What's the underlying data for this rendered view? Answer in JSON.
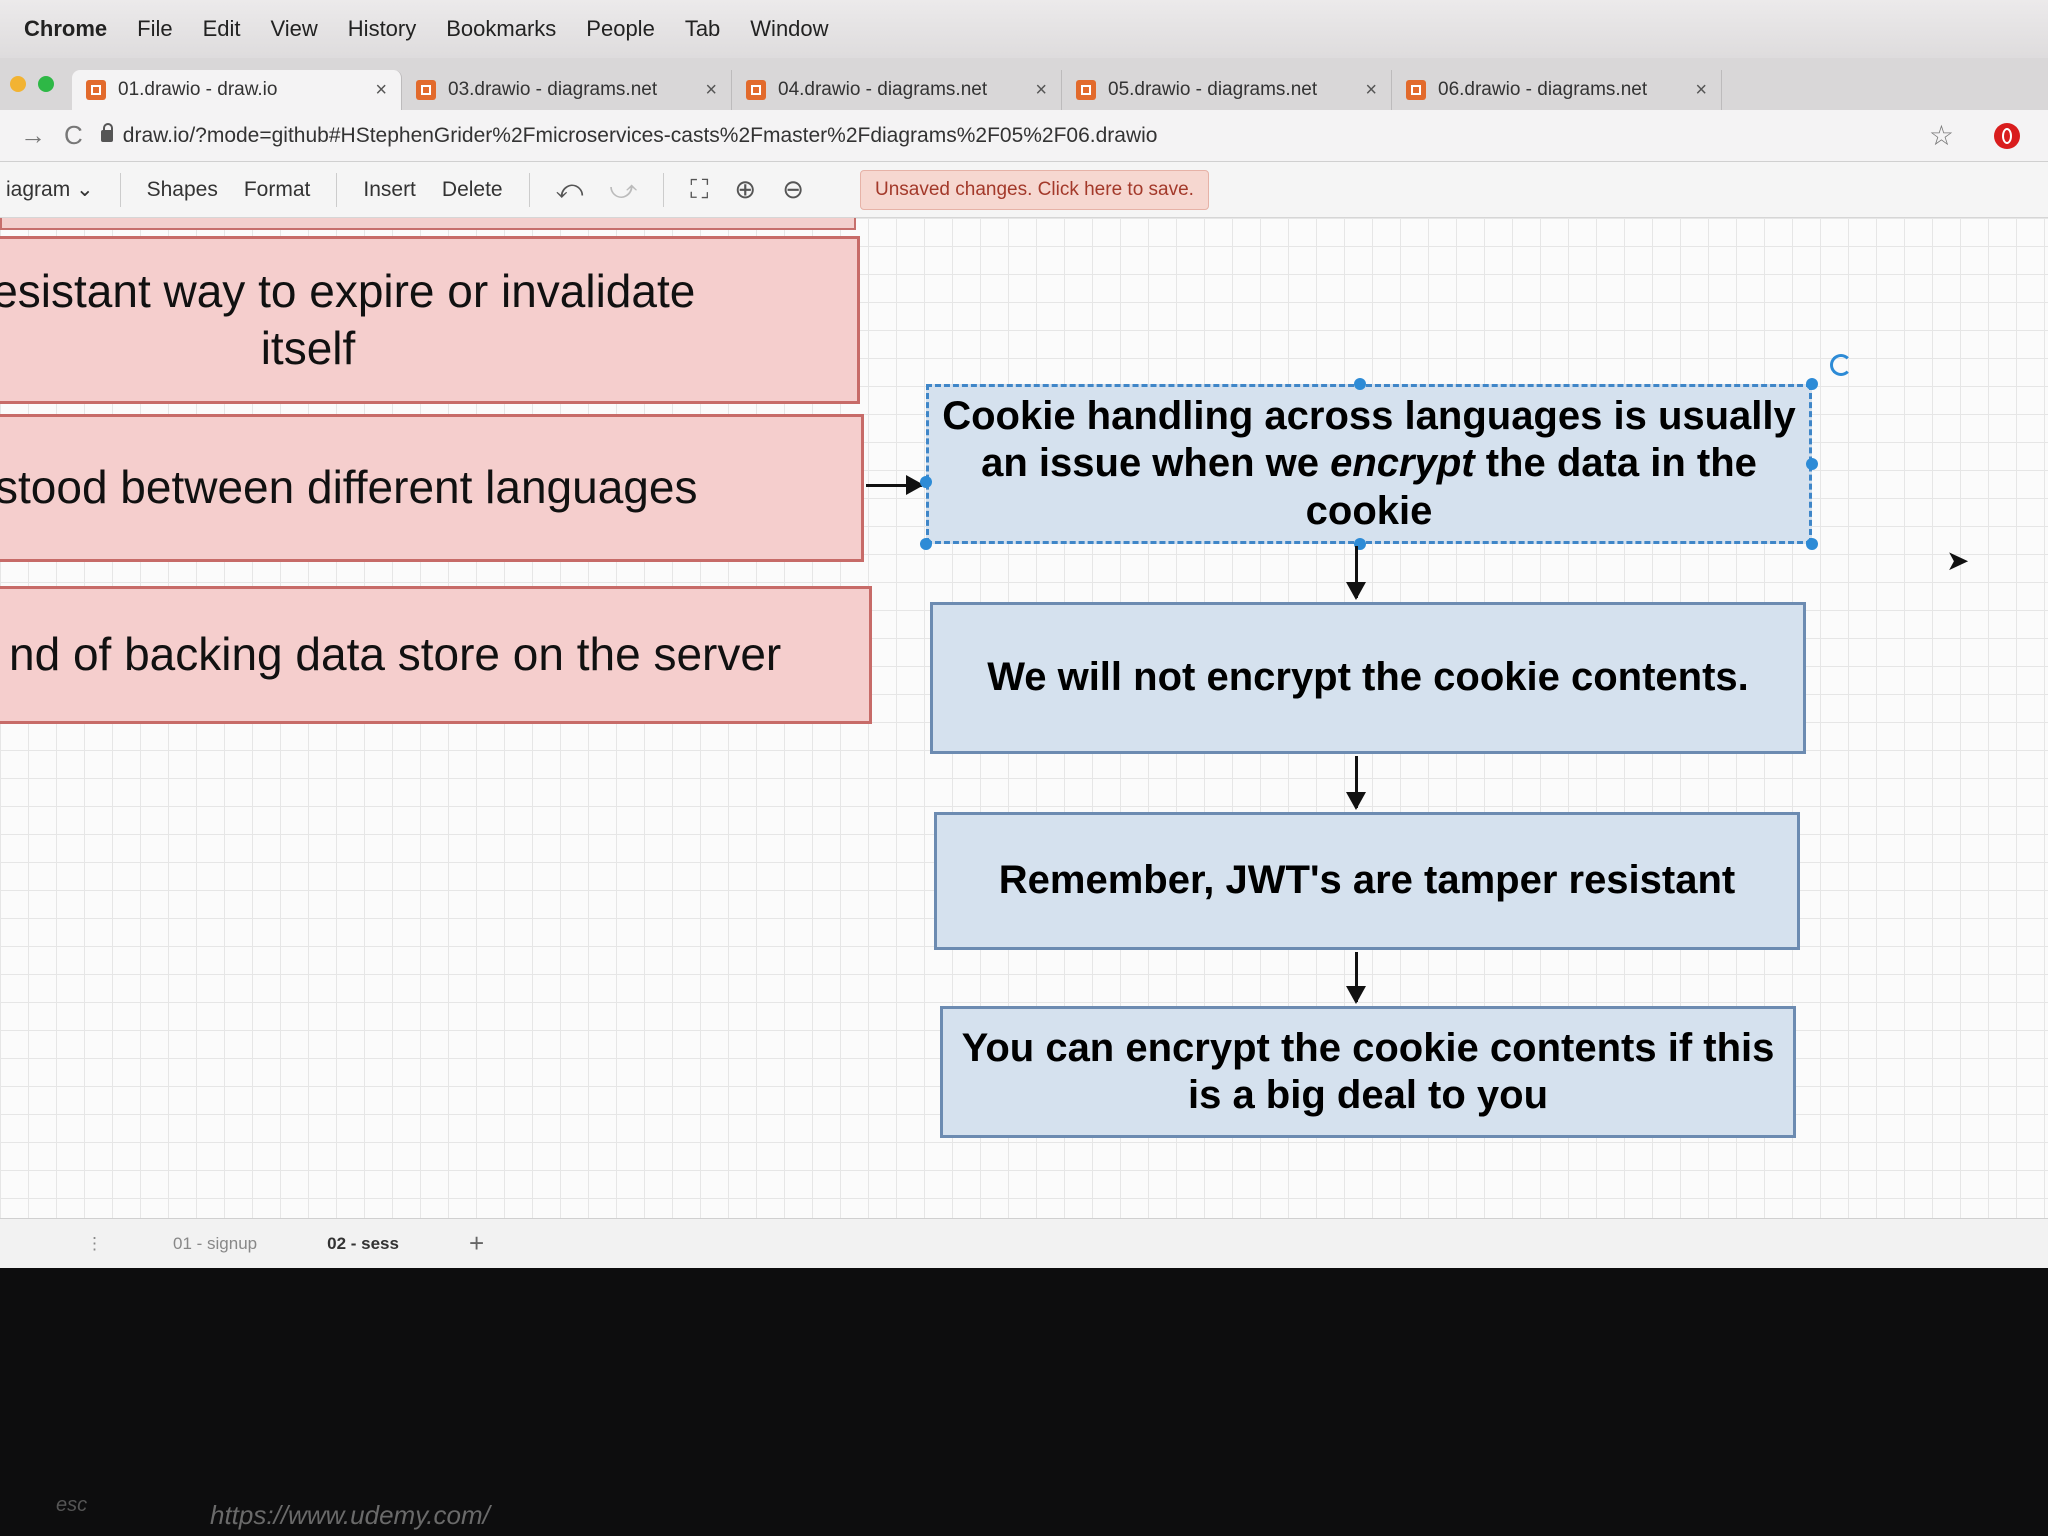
{
  "menubar": {
    "app": "Chrome",
    "items": [
      "File",
      "Edit",
      "View",
      "History",
      "Bookmarks",
      "People",
      "Tab",
      "Window"
    ]
  },
  "tabs": [
    {
      "title": "01.drawio - draw.io",
      "close": "×"
    },
    {
      "title": "03.drawio - diagrams.net",
      "close": "×"
    },
    {
      "title": "04.drawio - diagrams.net",
      "close": "×"
    },
    {
      "title": "05.drawio - diagrams.net",
      "close": "×"
    },
    {
      "title": "06.drawio - diagrams.net",
      "close": "×"
    }
  ],
  "address": {
    "url": "draw.io/?mode=github#HStephenGrider%2Fmicroservices-casts%2Fmaster%2Fdiagrams%2F05%2F06.drawio",
    "back": "←",
    "forward": "→",
    "reload": "C",
    "bookmark_icon": "star-icon"
  },
  "toolbar": {
    "diagram": "iagram ⌄",
    "shapes": "Shapes",
    "format": "Format",
    "insert": "Insert",
    "delete": "Delete",
    "undo": "⤺",
    "redo": "⤻",
    "fit": "⛶",
    "zoom_in": "⊕",
    "zoom_out": "⊖",
    "unsaved": "Unsaved changes. Click here to save."
  },
  "diagram": {
    "left_boxes": [
      "er-resistant way to expire or invalidate itself",
      "stood between different languages",
      "nd of backing data store on the server"
    ],
    "flow": {
      "box1_a": "Cookie handling across languages is usually an issue when we ",
      "box1_em": "encrypt",
      "box1_b": " the data in the cookie",
      "box2": "We will not encrypt the cookie contents.",
      "box3": "Remember, JWT's are tamper resistant",
      "box4": "You can encrypt the cookie contents if this is a big deal to you"
    }
  },
  "pages": {
    "menu": "⋮",
    "page1": "01 - signup",
    "page2": "02 - sess",
    "add": "+"
  },
  "bottom": {
    "url_overlay": "https://www.udemy.com/",
    "esc": "esc"
  },
  "colors": {
    "red_fill": "#f5cecd",
    "red_border": "#c76b68",
    "blue_fill": "#d5e1ee",
    "blue_border": "#6c8bb1",
    "selection": "#2d8bd6"
  }
}
